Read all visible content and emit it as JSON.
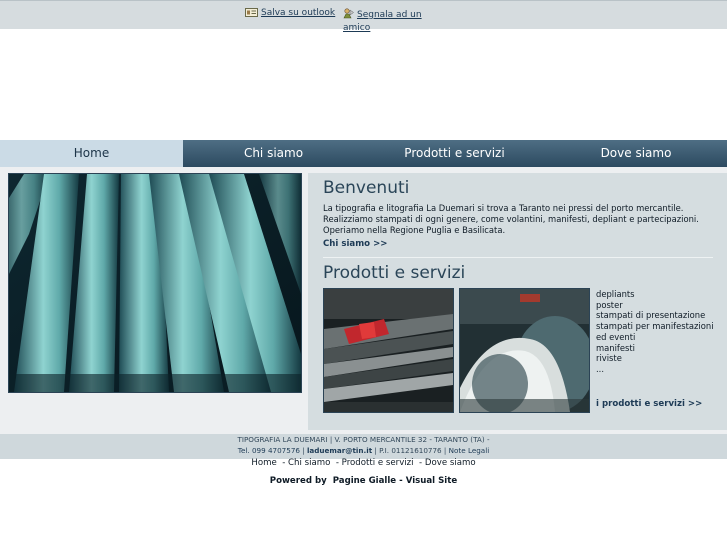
{
  "top_links": {
    "save_outlook": "Salva su outlook",
    "recommend": "Segnala ad un amico"
  },
  "nav": {
    "items": [
      "Home",
      "Chi siamo",
      "Prodotti e servizi",
      "Dove siamo"
    ],
    "active": "Home"
  },
  "welcome": {
    "title": "Benvenuti",
    "text": "La tipografia e litografia La Duemari si trova a Taranto nei pressi del porto mercantile. Realizziamo stampati di ogni genere, come volantini, manifesti, depliant e partecipazioni. Operiamo nella Regione Puglia e Basilicata.",
    "more": "Chi siamo >>"
  },
  "products": {
    "title": "Prodotti e servizi",
    "items": [
      "depliants",
      "poster",
      "stampati di presentazione",
      "stampati per manifestazioni ed eventi",
      "manifesti",
      "riviste",
      "..."
    ],
    "more": "i prodotti e servizi >>"
  },
  "footer": {
    "line1": "TIPOGRAFIA LA DUEMARI | V. PORTO MERCANTILE 32 - TARANTO (TA) -",
    "tel": "Tel. 099 4707576",
    "email": "laduemar@tin.it",
    "piva": "P.I. 01121610776",
    "legal": "Note Legali",
    "links": [
      "Home",
      "Chi siamo",
      "Prodotti e servizi",
      "Dove siamo"
    ],
    "powered_prefix": "Powered by",
    "powered_links": [
      "Pagine Gialle",
      "Visual Site"
    ],
    "powered_sep": "-"
  },
  "colors": {
    "nav_dark": "#2c4a60",
    "nav_active": "#cbdbe6",
    "panel": "#d5dde0",
    "heading": "#2a4558"
  }
}
